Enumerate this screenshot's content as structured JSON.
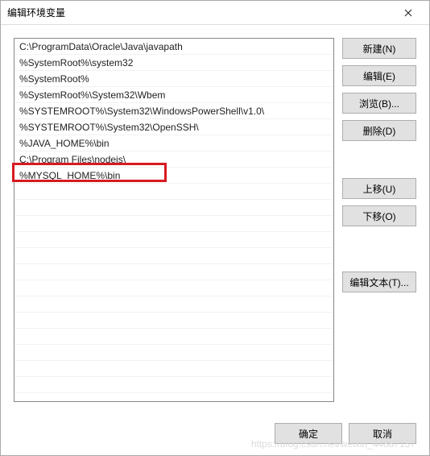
{
  "title": "编辑环境变量",
  "list": {
    "items": [
      "C:\\ProgramData\\Oracle\\Java\\javapath",
      "%SystemRoot%\\system32",
      "%SystemRoot%",
      "%SystemRoot%\\System32\\Wbem",
      "%SYSTEMROOT%\\System32\\WindowsPowerShell\\v1.0\\",
      "%SYSTEMROOT%\\System32\\OpenSSH\\",
      "%JAVA_HOME%\\bin",
      "C:\\Program Files\\nodejs\\",
      "%MYSQL_HOME%\\bin"
    ],
    "highlighted_index": 8
  },
  "buttons": {
    "new": "新建(N)",
    "edit": "编辑(E)",
    "browse": "浏览(B)...",
    "delete": "删除(D)",
    "move_up": "上移(U)",
    "move_down": "下移(O)",
    "edit_text": "编辑文本(T)...",
    "ok": "确定",
    "cancel": "取消"
  },
  "watermark": "https://blog.csdn.net/weixin_44887137"
}
